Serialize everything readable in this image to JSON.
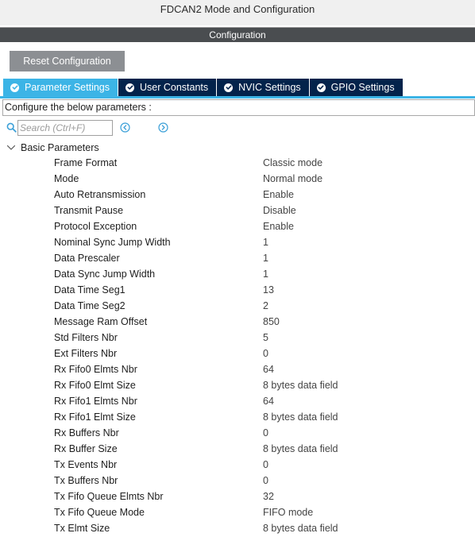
{
  "window": {
    "title": "FDCAN2 Mode and Configuration"
  },
  "config_header": "Configuration",
  "reset_button": "Reset Configuration",
  "tabs": [
    {
      "label": "Parameter Settings",
      "active": true
    },
    {
      "label": "User Constants",
      "active": false
    },
    {
      "label": "NVIC Settings",
      "active": false
    },
    {
      "label": "GPIO Settings",
      "active": false
    }
  ],
  "hint": "Configure the below parameters :",
  "search": {
    "placeholder": "Search (Ctrl+F)",
    "value": ""
  },
  "group": {
    "label": "Basic Parameters",
    "expanded": true
  },
  "params": [
    {
      "name": "Frame Format",
      "value": "Classic mode"
    },
    {
      "name": "Mode",
      "value": "Normal mode"
    },
    {
      "name": "Auto Retransmission",
      "value": "Enable"
    },
    {
      "name": "Transmit Pause",
      "value": "Disable"
    },
    {
      "name": "Protocol Exception",
      "value": "Enable"
    },
    {
      "name": "Nominal Sync Jump Width",
      "value": "1"
    },
    {
      "name": "Data Prescaler",
      "value": "1"
    },
    {
      "name": "Data Sync Jump Width",
      "value": "1"
    },
    {
      "name": "Data Time Seg1",
      "value": "13"
    },
    {
      "name": "Data Time Seg2",
      "value": "2"
    },
    {
      "name": "Message Ram Offset",
      "value": "850"
    },
    {
      "name": "Std Filters Nbr",
      "value": "5"
    },
    {
      "name": "Ext Filters Nbr",
      "value": "0"
    },
    {
      "name": "Rx Fifo0 Elmts Nbr",
      "value": "64"
    },
    {
      "name": "Rx Fifo0 Elmt Size",
      "value": "8 bytes data field"
    },
    {
      "name": "Rx Fifo1 Elmts Nbr",
      "value": "64"
    },
    {
      "name": "Rx Fifo1 Elmt Size",
      "value": "8 bytes data field"
    },
    {
      "name": "Rx Buffers Nbr",
      "value": "0"
    },
    {
      "name": "Rx Buffer Size",
      "value": "8 bytes data field"
    },
    {
      "name": "Tx Events Nbr",
      "value": "0"
    },
    {
      "name": "Tx Buffers Nbr",
      "value": "0"
    },
    {
      "name": "Tx Fifo Queue Elmts Nbr",
      "value": "32"
    },
    {
      "name": "Tx Fifo Queue Mode",
      "value": "FIFO mode"
    },
    {
      "name": "Tx Elmt Size",
      "value": "8 bytes data field"
    }
  ],
  "colors": {
    "accent": "#3cb4e6",
    "tab_inactive": "#03234b",
    "header_bar": "#4a4d50",
    "button": "#8c8f93"
  },
  "icons": {
    "tab_status": "check-circle-icon",
    "search": "search-icon",
    "prev": "arrow-left-circle-icon",
    "next": "arrow-right-circle-icon",
    "group_toggle": "chevron-down-icon"
  }
}
